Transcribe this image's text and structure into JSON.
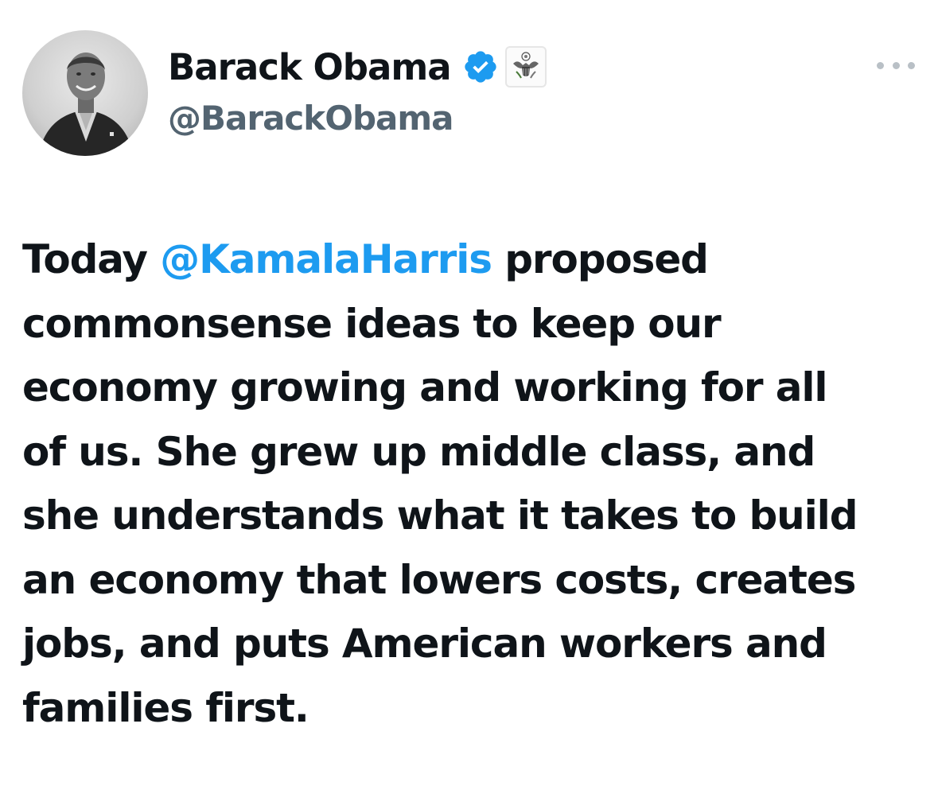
{
  "author": {
    "display_name": "Barack Obama",
    "handle": "@BarackObama",
    "verified_icon": "verified-badge-icon",
    "affiliation_icon": "us-government-seal-icon",
    "avatar_icon": "profile-photo"
  },
  "menu": {
    "more_icon": "more-options-icon"
  },
  "tweet": {
    "lines": [
      {
        "before": "Today ",
        "mention": "@KamalaHarris",
        "after": " proposed"
      },
      {
        "text": "commonsense ideas to keep our"
      },
      {
        "text": "economy growing and working for all"
      },
      {
        "text": "of us. She grew up middle class, and"
      },
      {
        "text": "she understands what it takes to build"
      },
      {
        "text": "an economy that lowers costs, creates"
      },
      {
        "text": "jobs, and puts American workers and"
      },
      {
        "text": "families first."
      }
    ]
  },
  "colors": {
    "text": "#0f1419",
    "secondary_text": "#536471",
    "mention": "#1d9bf0",
    "verified": "#1d9bf0",
    "more_dots": "#b9c0c6"
  }
}
